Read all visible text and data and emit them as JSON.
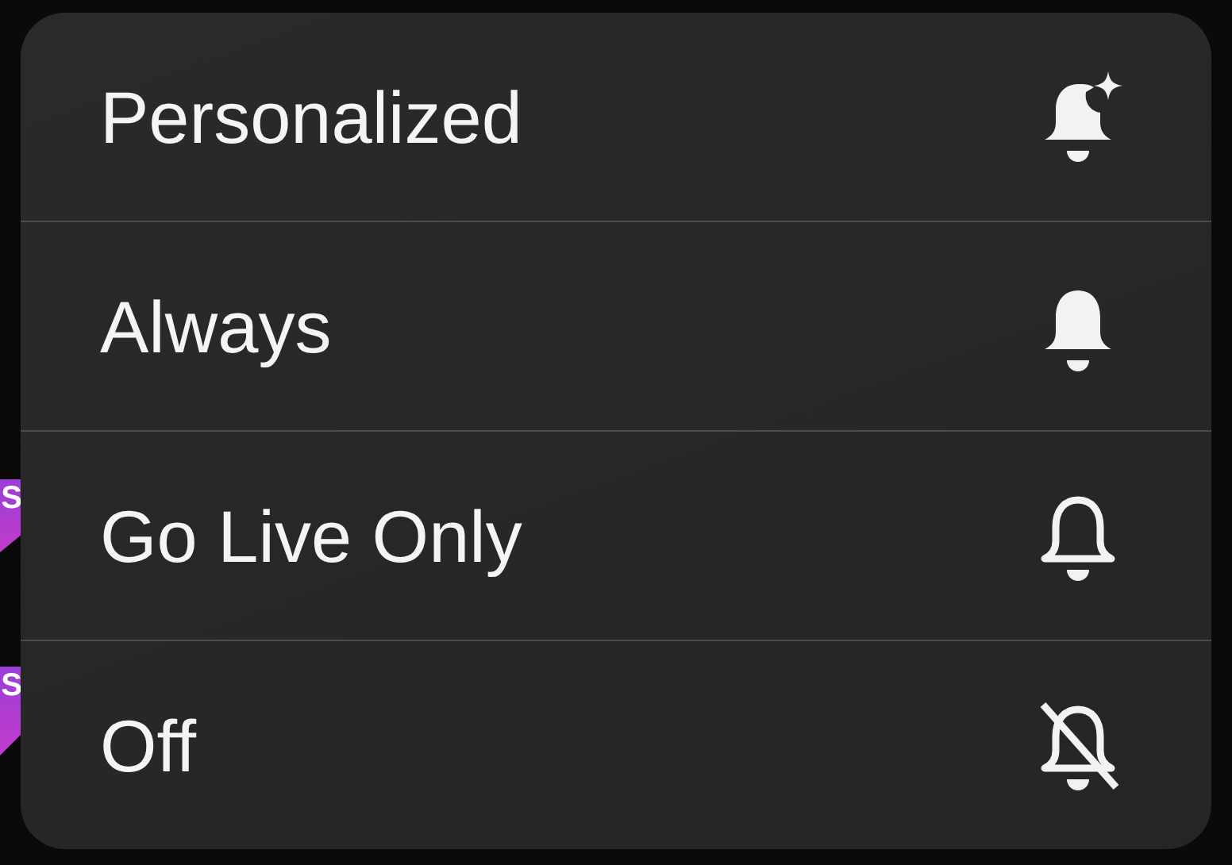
{
  "background": {
    "badges": [
      {
        "label": "S"
      },
      {
        "label": "S"
      }
    ]
  },
  "menu": {
    "items": [
      {
        "label": "Personalized",
        "kind": "sparkle"
      },
      {
        "label": "Always",
        "kind": "filled"
      },
      {
        "label": "Go Live Only",
        "kind": "outline"
      },
      {
        "label": "Off",
        "kind": "slashed"
      }
    ]
  }
}
